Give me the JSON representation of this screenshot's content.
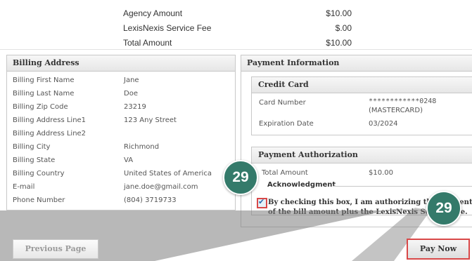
{
  "summary": {
    "rows": [
      {
        "label": "Agency Amount",
        "value": "$10.00"
      },
      {
        "label": "LexisNexis Service Fee",
        "value": "$.00"
      },
      {
        "label": "Total Amount",
        "value": "$10.00"
      }
    ]
  },
  "billing": {
    "title": "Billing Address",
    "rows": [
      {
        "label": "Billing First Name",
        "value": "Jane"
      },
      {
        "label": "Billing Last Name",
        "value": "Doe"
      },
      {
        "label": "Billing Zip Code",
        "value": "23219"
      },
      {
        "label": "Billing Address Line1",
        "value": "123 Any Street"
      },
      {
        "label": "Billing Address Line2",
        "value": ""
      },
      {
        "label": "Billing City",
        "value": "Richmond"
      },
      {
        "label": "Billing State",
        "value": "VA"
      },
      {
        "label": "Billing Country",
        "value": "United States of America"
      },
      {
        "label": "E-mail",
        "value": "jane.doe@gmail.com"
      },
      {
        "label": "Phone Number",
        "value": "(804) 3719733"
      }
    ]
  },
  "payment": {
    "title": "Payment Information",
    "credit_card": {
      "title": "Credit Card",
      "card_number_label": "Card Number",
      "card_number_value": "************0248",
      "card_type": "(MASTERCARD)",
      "expiration_label": "Expiration Date",
      "expiration_value": "03/2024"
    },
    "authorization": {
      "title": "Payment Authorization",
      "total_label": "Total Amount",
      "total_value": "$10.00",
      "ack_legend": "Acknowledgment",
      "ack_text": "By checking this box, I am authorizing the payment of the bill amount plus the LexisNexis Service Fee.",
      "ack_checked": true
    }
  },
  "callouts": {
    "step_left": "29",
    "step_right": "29",
    "color": "#347a6a",
    "highlight": "#d94848"
  },
  "buttons": {
    "previous": "Previous Page",
    "pay_now": "Pay Now"
  }
}
